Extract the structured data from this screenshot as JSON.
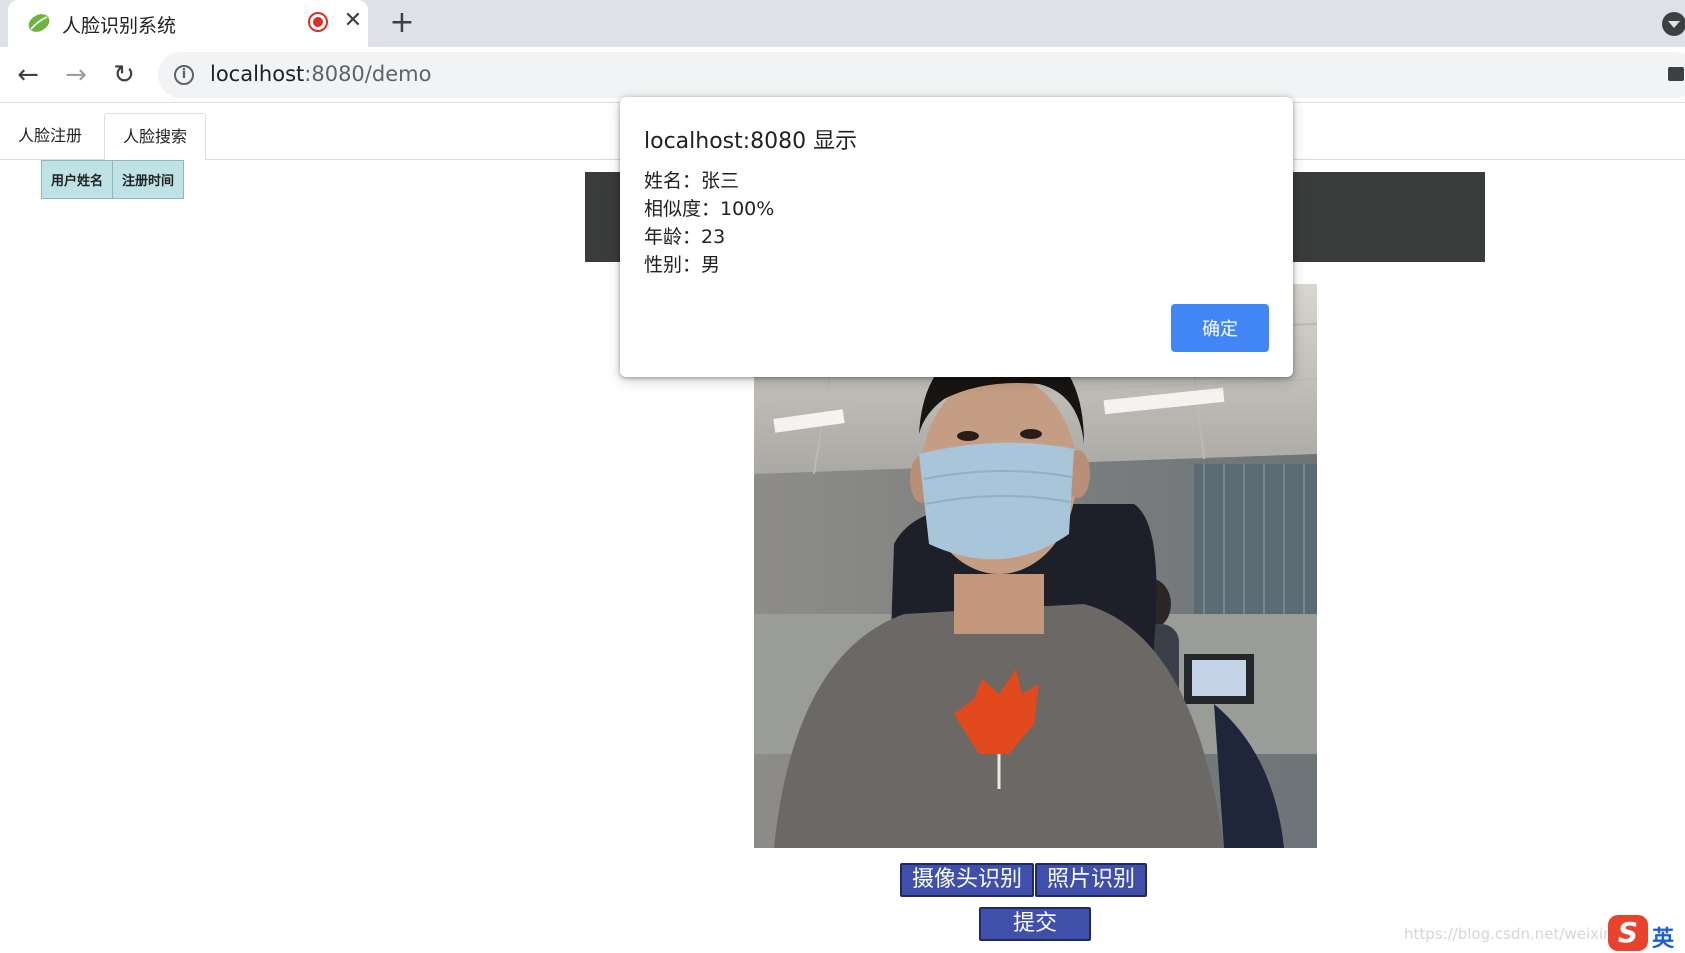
{
  "browser": {
    "tab_title": "人脸识别系统",
    "new_tab_symbol": "+",
    "close_symbol": "✕",
    "url_host": "localhost",
    "url_rest": ":8080/demo",
    "back_symbol": "←",
    "forward_symbol": "→",
    "reload_symbol": "↻",
    "info_symbol": "i"
  },
  "nav": {
    "tabs": [
      {
        "label": "人脸注册"
      },
      {
        "label": "人脸搜索"
      }
    ]
  },
  "table": {
    "headers": [
      "用户姓名",
      "注册时间"
    ]
  },
  "dialog": {
    "title": "localhost:8080 显示",
    "lines": [
      "姓名：张三",
      "相似度：100%",
      "年龄：23",
      "性别：男"
    ],
    "ok_label": "确定"
  },
  "actions": {
    "camera_label": "摄像头识别",
    "photo_label": "照片识别",
    "submit_label": "提交"
  },
  "watermark": "https://blog.csdn.net/weixin_",
  "ime": {
    "logo": "S",
    "mode": "英"
  },
  "colors": {
    "button_blue": "#3f4faa",
    "dialog_ok": "#4285f4",
    "table_header_bg": "#bfe2e4",
    "banner_dark": "#3a3b3b"
  }
}
